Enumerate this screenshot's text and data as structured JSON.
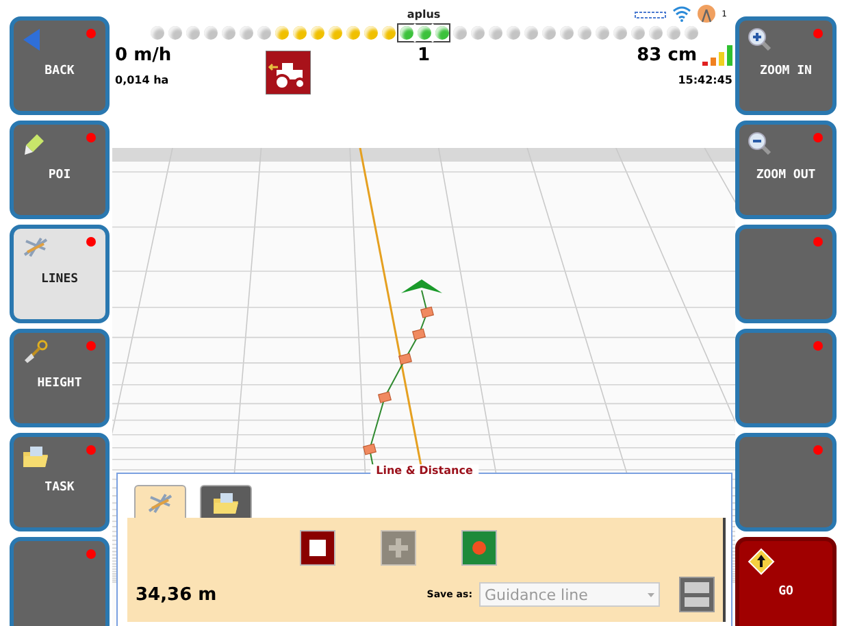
{
  "left_buttons": [
    {
      "kind": "back",
      "label": "BACK",
      "selected": false,
      "alert": true
    },
    {
      "kind": "poi",
      "label": "POI",
      "selected": false,
      "alert": true
    },
    {
      "kind": "lines",
      "label": "LINES",
      "selected": true,
      "alert": true
    },
    {
      "kind": "height",
      "label": "HEIGHT",
      "selected": false,
      "alert": true
    },
    {
      "kind": "task",
      "label": "TASK",
      "selected": false,
      "alert": true
    },
    {
      "kind": "empty",
      "selected": false,
      "alert": true
    }
  ],
  "right_buttons": [
    {
      "kind": "zoom-in",
      "label": "ZOOM IN",
      "alert": true
    },
    {
      "kind": "zoom-out",
      "label": "ZOOM OUT",
      "alert": true
    },
    {
      "kind": "empty",
      "alert": true
    },
    {
      "kind": "empty",
      "alert": true
    },
    {
      "kind": "empty",
      "alert": true
    },
    {
      "kind": "go",
      "label": "GO",
      "alert": false
    }
  ],
  "status": {
    "device": "aplus",
    "satellite_count": "1",
    "speed": "0 m/h",
    "area": "0,014 ha",
    "line_number": "1",
    "accuracy": "83 cm",
    "time": "15:42:45"
  },
  "leds": [
    {
      "color": "#c4c4c4",
      "selected": false
    },
    {
      "color": "#c4c4c4",
      "selected": false
    },
    {
      "color": "#c4c4c4",
      "selected": false
    },
    {
      "color": "#c4c4c4",
      "selected": false
    },
    {
      "color": "#c4c4c4",
      "selected": false
    },
    {
      "color": "#c4c4c4",
      "selected": false
    },
    {
      "color": "#c4c4c4",
      "selected": false
    },
    {
      "color": "#f0c000",
      "selected": false
    },
    {
      "color": "#f0c000",
      "selected": false
    },
    {
      "color": "#f0c000",
      "selected": false
    },
    {
      "color": "#f0c000",
      "selected": false
    },
    {
      "color": "#f0c000",
      "selected": false
    },
    {
      "color": "#f0c000",
      "selected": false
    },
    {
      "color": "#f0c000",
      "selected": false
    },
    {
      "color": "#3cc23c",
      "selected": true
    },
    {
      "color": "#3cc23c",
      "selected": true
    },
    {
      "color": "#3cc23c",
      "selected": true
    },
    {
      "color": "#c4c4c4",
      "selected": false
    },
    {
      "color": "#c4c4c4",
      "selected": false
    },
    {
      "color": "#c4c4c4",
      "selected": false
    },
    {
      "color": "#c4c4c4",
      "selected": false
    },
    {
      "color": "#c4c4c4",
      "selected": false
    },
    {
      "color": "#c4c4c4",
      "selected": false
    },
    {
      "color": "#c4c4c4",
      "selected": false
    },
    {
      "color": "#c4c4c4",
      "selected": false
    },
    {
      "color": "#c4c4c4",
      "selected": false
    },
    {
      "color": "#c4c4c4",
      "selected": false
    },
    {
      "color": "#c4c4c4",
      "selected": false
    },
    {
      "color": "#c4c4c4",
      "selected": false
    },
    {
      "color": "#c4c4c4",
      "selected": false
    },
    {
      "color": "#c4c4c4",
      "selected": false
    }
  ],
  "panel": {
    "title": "Line & Distance",
    "tabs": [
      {
        "kind": "lines",
        "selected": true
      },
      {
        "kind": "task",
        "selected": false
      }
    ],
    "actions": [
      {
        "kind": "stop",
        "disabled": false
      },
      {
        "kind": "add",
        "disabled": true
      },
      {
        "kind": "record",
        "disabled": false
      }
    ],
    "distance": "34,36 m",
    "save_label": "Save as:",
    "save_value": "Guidance line",
    "save_disabled": true
  }
}
